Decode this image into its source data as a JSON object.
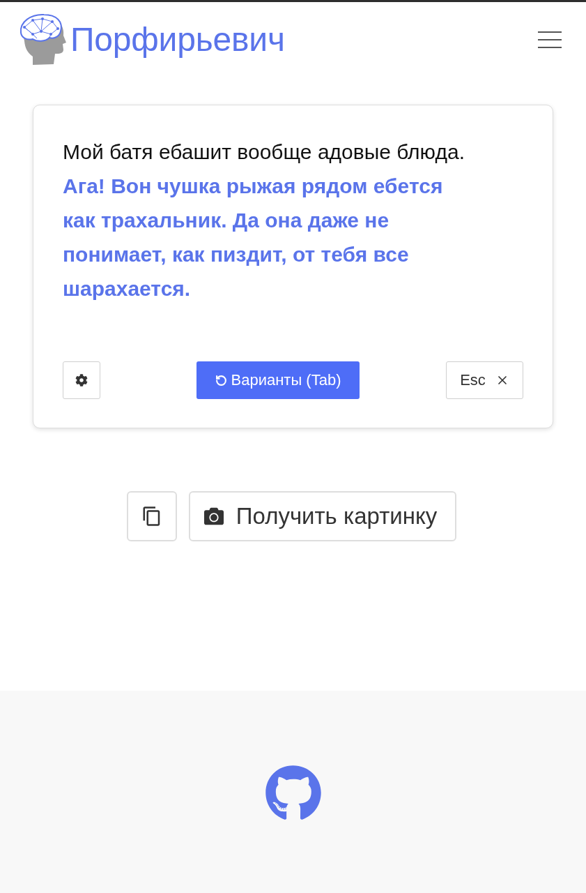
{
  "header": {
    "brand": "Порфирьевич"
  },
  "editor": {
    "text": "Мой батя ебашит вообще адовые блюда. **Ага! Вон чушка рыжая рядом ебется как трахальник. Да она даже не понимает, как пиздит, от тебя все шарахается.**"
  },
  "toolbar": {
    "variants_button": "Варианты (Tab)",
    "close_button": "Esc"
  },
  "actions": {
    "image_button": "Получить картинку"
  }
}
